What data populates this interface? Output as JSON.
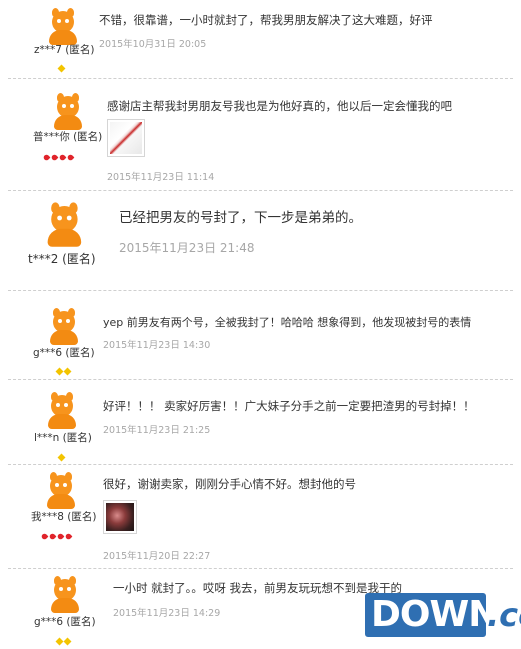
{
  "reviews": [
    {
      "user": "z***7 (匿名)",
      "text": "不错，很靠谱，一小时就封了，帮我男朋友解决了这大难题，好评",
      "date": "2015年10月31日 20:05",
      "rank": "yellow",
      "rank_count": 1
    },
    {
      "user": "普***你 (匿名)",
      "text": "感谢店主帮我封男朋友号我也是为他好真的，他以后一定会懂我的吧",
      "date": "2015年11月23日 11:14",
      "rank": "red",
      "rank_count": 4,
      "has_image": true
    },
    {
      "user": "t***2 (匿名)",
      "text": "已经把男友的号封了，下一步是弟弟的。",
      "date": "2015年11月23日  21:48",
      "rank": "none",
      "rank_count": 0
    },
    {
      "user": "g***6 (匿名)",
      "text": "yep 前男友有两个号，全被我封了！哈哈哈 想象得到，他发现被封号的表情",
      "date": "2015年11月23日 14:30",
      "rank": "yellow",
      "rank_count": 2
    },
    {
      "user": "l***n (匿名)",
      "text": "好评！！！ 卖家好厉害！！广大妹子分手之前一定要把渣男的号封掉！！",
      "date": "2015年11月23日 21:25",
      "rank": "yellow",
      "rank_count": 1
    },
    {
      "user": "我***8 (匿名)",
      "text": "很好，谢谢卖家，刚刚分手心情不好。想封他的号",
      "date": "2015年11月20日 22:27",
      "rank": "red",
      "rank_count": 4,
      "has_image": true
    },
    {
      "user": "g***6 (匿名)",
      "text": "一小时 就封了。。哎呀 我去，前男友玩玩想不到是我干的",
      "date": "2015年11月23日 14:29",
      "rank": "yellow",
      "rank_count": 2
    }
  ],
  "watermark": {
    "main": "DOWN",
    "suffix": ".cc"
  },
  "colors": {
    "avatar": "#f7941d",
    "date": "#a7a7a7",
    "watermark": "#2f6fb2"
  }
}
